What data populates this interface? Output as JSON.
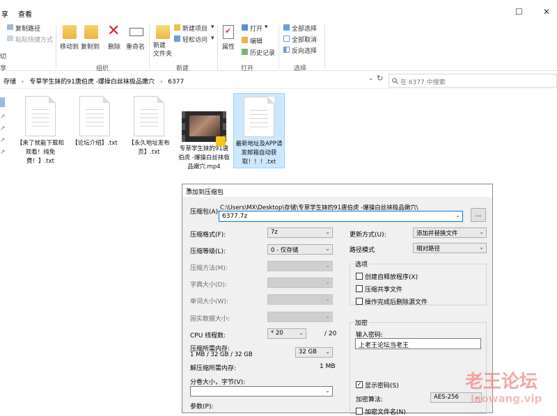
{
  "explorer": {
    "tabs": [
      "享",
      "查看"
    ],
    "window_controls": {
      "maximize": "☐",
      "close": "✕"
    },
    "ribbon": {
      "clipboard": {
        "copy_path": "复制路径",
        "paste_shortcut": "粘贴快捷方式",
        "cut_partial": "切",
        "group": ""
      },
      "organize": {
        "move_to": "移动到",
        "copy_to": "复制到",
        "delete": "删除",
        "rename": "重命名",
        "group": "组织"
      },
      "new": {
        "new_folder": "新建\n文件夹",
        "new_item": "新建项目",
        "easy_access": "轻松访问",
        "group": "新建"
      },
      "open": {
        "properties": "属性",
        "open": "打开",
        "edit": "编辑",
        "history": "历史记录",
        "group": "打开"
      },
      "select": {
        "select_all": "全部选择",
        "select_none": "全部取消",
        "invert": "反向选择",
        "group": "选择"
      }
    },
    "breadcrumb": [
      "存储",
      "专草学生妹的91唐伯虎 -爆操白丝袜极品嫩穴",
      "6377"
    ],
    "search_placeholder": "在 6377 中搜索",
    "files": [
      {
        "name": "【来了就能下载和观看！纯免费！】.txt",
        "type": "txt"
      },
      {
        "name": "【论坛介绍】.txt",
        "type": "txt"
      },
      {
        "name": "【永久地址发布页】.txt",
        "type": "txt"
      },
      {
        "name": "专草学生妹的91唐伯虎 -爆操白丝袜极品嫩穴.mp4",
        "type": "mp4"
      },
      {
        "name": "最新地址及APP请发邮箱自动获取！！！.txt",
        "type": "txt",
        "selected": true
      }
    ]
  },
  "dialog": {
    "title": "添加到压缩包",
    "close": "✕",
    "archive_label": "压缩包(A):",
    "archive_path": "C:\\Users\\MX\\Desktop\\存储\\专草学生妹的91唐伯虎 -爆操白丝袜极品嫩穴\\",
    "archive_name": "6377.7z",
    "browse": "...",
    "format_label": "压缩格式(F):",
    "format_value": "7z",
    "level_label": "压缩等级(L):",
    "level_value": "0 - 仅存储",
    "method_label": "压缩方法(M):",
    "dict_label": "字典大小(D):",
    "word_label": "单词大小(W):",
    "solid_label": "固实数据大小:",
    "cpu_label": "CPU 线程数:",
    "cpu_value": "* 20",
    "cpu_total": "/ 20",
    "mem_comp_label": "压缩所需内存:",
    "mem_comp_detail": "1 MB / 32 GB / 32 GB",
    "mem_comp_value": "32 GB",
    "mem_decomp_label": "解压缩所需内存:",
    "mem_decomp_value": "1 MB",
    "split_label": "分卷大小，字节(V):",
    "params_label": "参数(P):",
    "update_label": "更新方式(U):",
    "update_value": "添加并替换文件",
    "path_label": "路径模式",
    "path_value": "相对路径",
    "options_title": "选项",
    "options": [
      {
        "label": "创建自释放程序(X)",
        "checked": false
      },
      {
        "label": "压缩共享文件",
        "checked": false
      },
      {
        "label": "操作完成后删除源文件",
        "checked": false
      }
    ],
    "encrypt_title": "加密",
    "password_label": "输入密码:",
    "password_value": "上老王论坛当老王",
    "show_password": {
      "label": "显示密码(S)",
      "checked": true
    },
    "encrypt_method_label": "加密算法:",
    "encrypt_method_value": "AES-256",
    "encrypt_names": {
      "label": "加密文件名(N)",
      "checked": false
    }
  },
  "watermark": {
    "line1": "老王论坛",
    "line2": "laowang.vip"
  }
}
